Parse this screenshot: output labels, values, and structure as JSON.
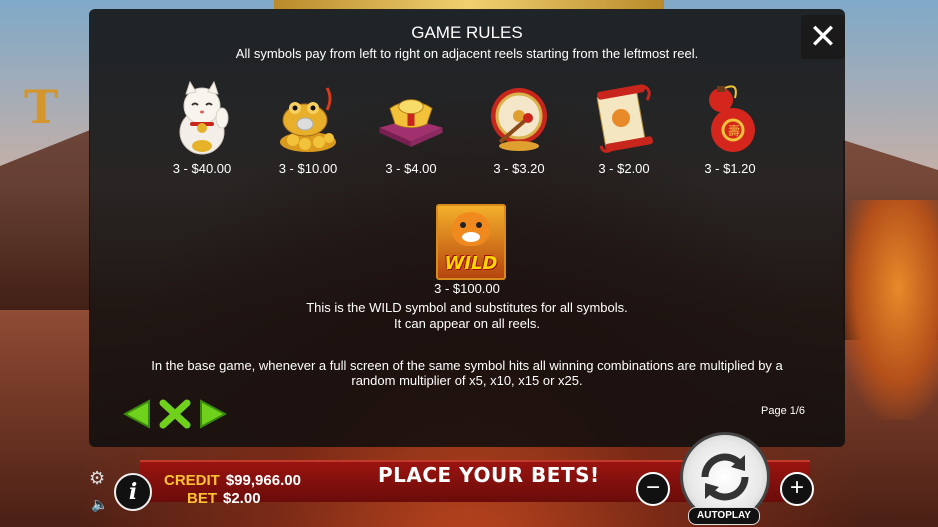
{
  "game": {
    "title": "GAME RULES",
    "subtitle": "All symbols pay from left to right on adjacent reels starting from the leftmost reel.",
    "close_label": "✕"
  },
  "symbols": [
    {
      "icon": "lucky-cat-icon",
      "pay": "3 - $40.00"
    },
    {
      "icon": "golden-toad-icon",
      "pay": "3 - $10.00"
    },
    {
      "icon": "gold-ingot-icon",
      "pay": "3 - $4.00"
    },
    {
      "icon": "drum-icon",
      "pay": "3 - $3.20"
    },
    {
      "icon": "scroll-icon",
      "pay": "3 - $2.00"
    },
    {
      "icon": "red-gourd-icon",
      "pay": "3 - $1.20"
    }
  ],
  "wild": {
    "label": "WILD",
    "pay": "3 - $100.00",
    "desc1": "This is the WILD symbol and substitutes for all symbols.",
    "desc2": "It can appear on all reels."
  },
  "base_game": {
    "line1": "In the base game, whenever a full screen of the same symbol hits all winning combinations are multiplied by a",
    "line2": "random multiplier of x5, x10, x15 or x25."
  },
  "pagination": {
    "label": "Page 1/6"
  },
  "bottom": {
    "credit_label": "CREDIT",
    "credit_value": "$99,966.00",
    "bet_label": "BET",
    "bet_value": "$2.00",
    "message": "PLACE YOUR BETS!",
    "autoplay_label": "AUTOPLAY",
    "minus": "−",
    "plus": "+",
    "info": "i"
  },
  "colors": {
    "accent_green": "#6fd11b",
    "label_yellow": "#ffc233",
    "bar_red": "#9a1410"
  }
}
